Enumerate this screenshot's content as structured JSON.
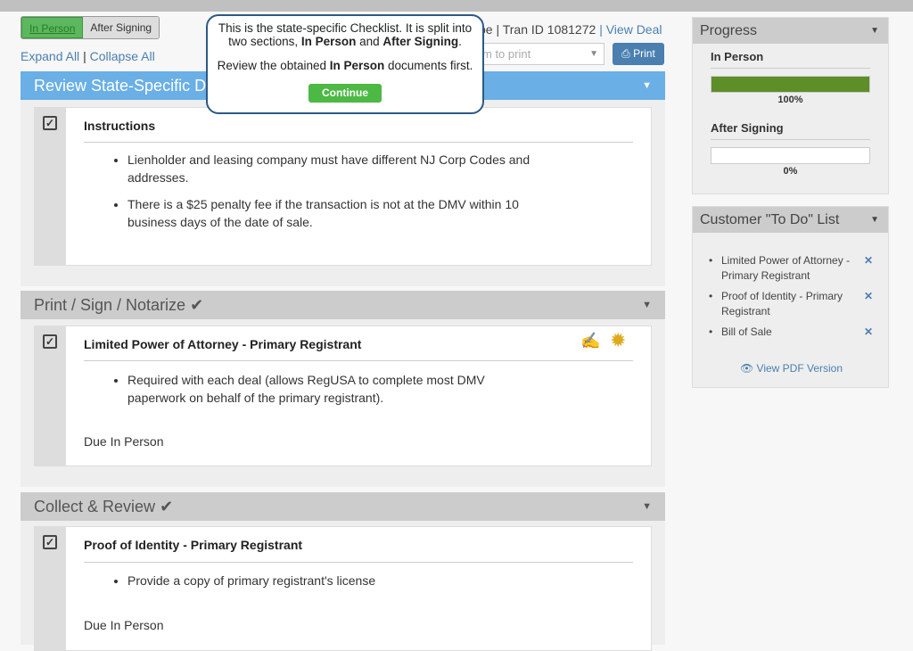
{
  "toggle": {
    "in_person": "In Person",
    "after_signing": "After Signing"
  },
  "links": {
    "expand_all": "Expand All",
    "separator": "|",
    "collapse_all": "Collapse All"
  },
  "header": {
    "partial_text": "pe | Tran ID 1081272",
    "view_deal": "| View Deal"
  },
  "print_select": {
    "placeholder": "m to print"
  },
  "print_button": {
    "label": "Print",
    "icon": "printer-icon"
  },
  "tooltip": {
    "line1": "This is the state-specific Checklist. It is split into",
    "line2_pre": "two sections, ",
    "line2_b1": "In Person",
    "line2_mid": " and ",
    "line2_b2": "After Signing",
    "line2_end": ".",
    "line3_pre": "Review the obtained ",
    "line3_b": "In Person",
    "line3_end": " documents first.",
    "continue": "Continue"
  },
  "sections": [
    {
      "title": "Review State-Specific Do",
      "card": {
        "title": "Instructions",
        "bullets": [
          "Lienholder and leasing company must have different NJ Corp Codes and addresses.",
          "There is a $25 penalty fee if the transaction is not at the DMV within 10 business days of the date of sale."
        ]
      }
    },
    {
      "title": "Print / Sign / Notarize",
      "card": {
        "title": "Limited Power of Attorney - Primary Registrant",
        "bullets": [
          "Required with each deal (allows RegUSA to complete most DMV paperwork on behalf of the primary registrant)."
        ],
        "due": "Due In Person"
      }
    },
    {
      "title": "Collect & Review",
      "card": {
        "title": "Proof of Identity - Primary Registrant",
        "bullets": [
          "Provide a copy of primary registrant's license"
        ],
        "due": "Due In Person"
      }
    }
  ],
  "progress": {
    "title": "Progress",
    "in_person": {
      "label": "In Person",
      "percent": 100,
      "text": "100%"
    },
    "after_signing": {
      "label": "After Signing",
      "percent": 0,
      "text": "0%"
    }
  },
  "todo": {
    "title": "Customer \"To Do\" List",
    "items": [
      "Limited Power of Attorney - Primary Registrant",
      "Proof of Identity - Primary Registrant",
      "Bill of Sale"
    ],
    "view_pdf": "View PDF Version"
  },
  "colors": {
    "header_blue": "#6aafe6",
    "progress_green": "#5e8e28",
    "continue_green": "#4cb944",
    "link": "#4a7fb0"
  }
}
